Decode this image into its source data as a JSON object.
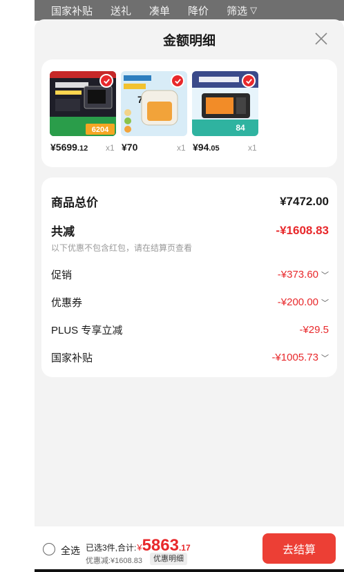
{
  "top_bar": {
    "tabs": [
      "国家补贴",
      "送礼",
      "凑单",
      "降价",
      "筛选"
    ],
    "filter_icon": "filter-funnel-icon"
  },
  "sheet": {
    "title": "金额明细",
    "close_icon": "close-icon"
  },
  "products": [
    {
      "price_int": "¥5699",
      "price_dec": ".12",
      "qty": "x1",
      "thumb_text": "6204",
      "colors": [
        "#1e1e28",
        "#2a9d4a"
      ]
    },
    {
      "price_int": "¥70",
      "price_dec": "",
      "qty": "x1",
      "thumb_text": "74",
      "colors": [
        "#d8ecf7",
        "#f2d38a"
      ]
    },
    {
      "price_int": "¥94",
      "price_dec": ".05",
      "qty": "x1",
      "thumb_text": "84",
      "colors": [
        "#3a4a8a",
        "#2fb3a0"
      ]
    }
  ],
  "details": {
    "total_label": "商品总价",
    "total_value": "¥7472.00",
    "discount_label": "共减",
    "discount_value": "-¥1608.83",
    "discount_note": "以下优惠不包含红包，请在结算页查看",
    "items": [
      {
        "label": "促销",
        "value": "-¥373.60",
        "expandable": true
      },
      {
        "label": "优惠券",
        "value": "-¥200.00",
        "expandable": true
      },
      {
        "label": "PLUS 专享立减",
        "value": "-¥29.5",
        "expandable": false
      },
      {
        "label": "国家补贴",
        "value": "-¥1005.73",
        "expandable": true
      }
    ]
  },
  "bottom": {
    "select_all": "全选",
    "summary_prefix": "已选3件,合计:",
    "currency": "¥",
    "total_int": "5863",
    "total_dec": ".17",
    "savings": "优惠减:¥1608.83",
    "detail_link": "优惠明细",
    "checkout": "去结算"
  },
  "colors": {
    "accent_red": "#e8282b",
    "checkout_red": "#ec3f35",
    "overlay_gray": "#6f6f6f",
    "sheet_bg": "#f3f3f3"
  }
}
